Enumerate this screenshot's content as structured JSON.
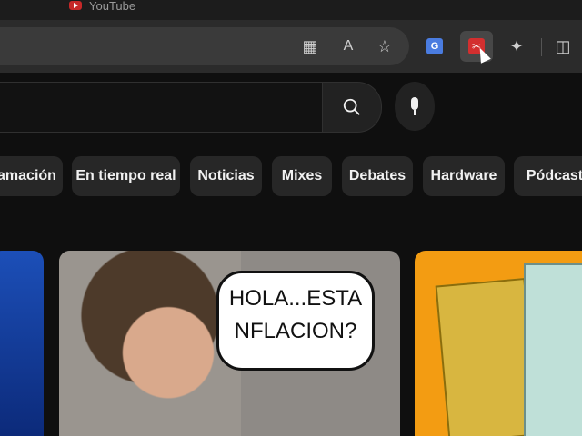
{
  "browser": {
    "tab_title": "YouTube",
    "icons": [
      "apps-icon",
      "read-aloud-icon",
      "favorite-star-icon",
      "google-translate-extension-icon",
      "red-extension-icon",
      "extensions-puzzle-icon",
      "split-screen-icon"
    ]
  },
  "youtube": {
    "search": {
      "value": ""
    },
    "chips": [
      "amación",
      "En tiempo real",
      "Noticias",
      "Mixes",
      "Debates",
      "Hardware",
      "Pódcast"
    ],
    "thumbnail_center": {
      "caption": "HOLA...ESTA NFLACION?"
    }
  },
  "colors": {
    "background": "#0f0f0f",
    "toolbar": "#2b2b2b",
    "chip": "#272727",
    "accent_red": "#d32f2f"
  }
}
